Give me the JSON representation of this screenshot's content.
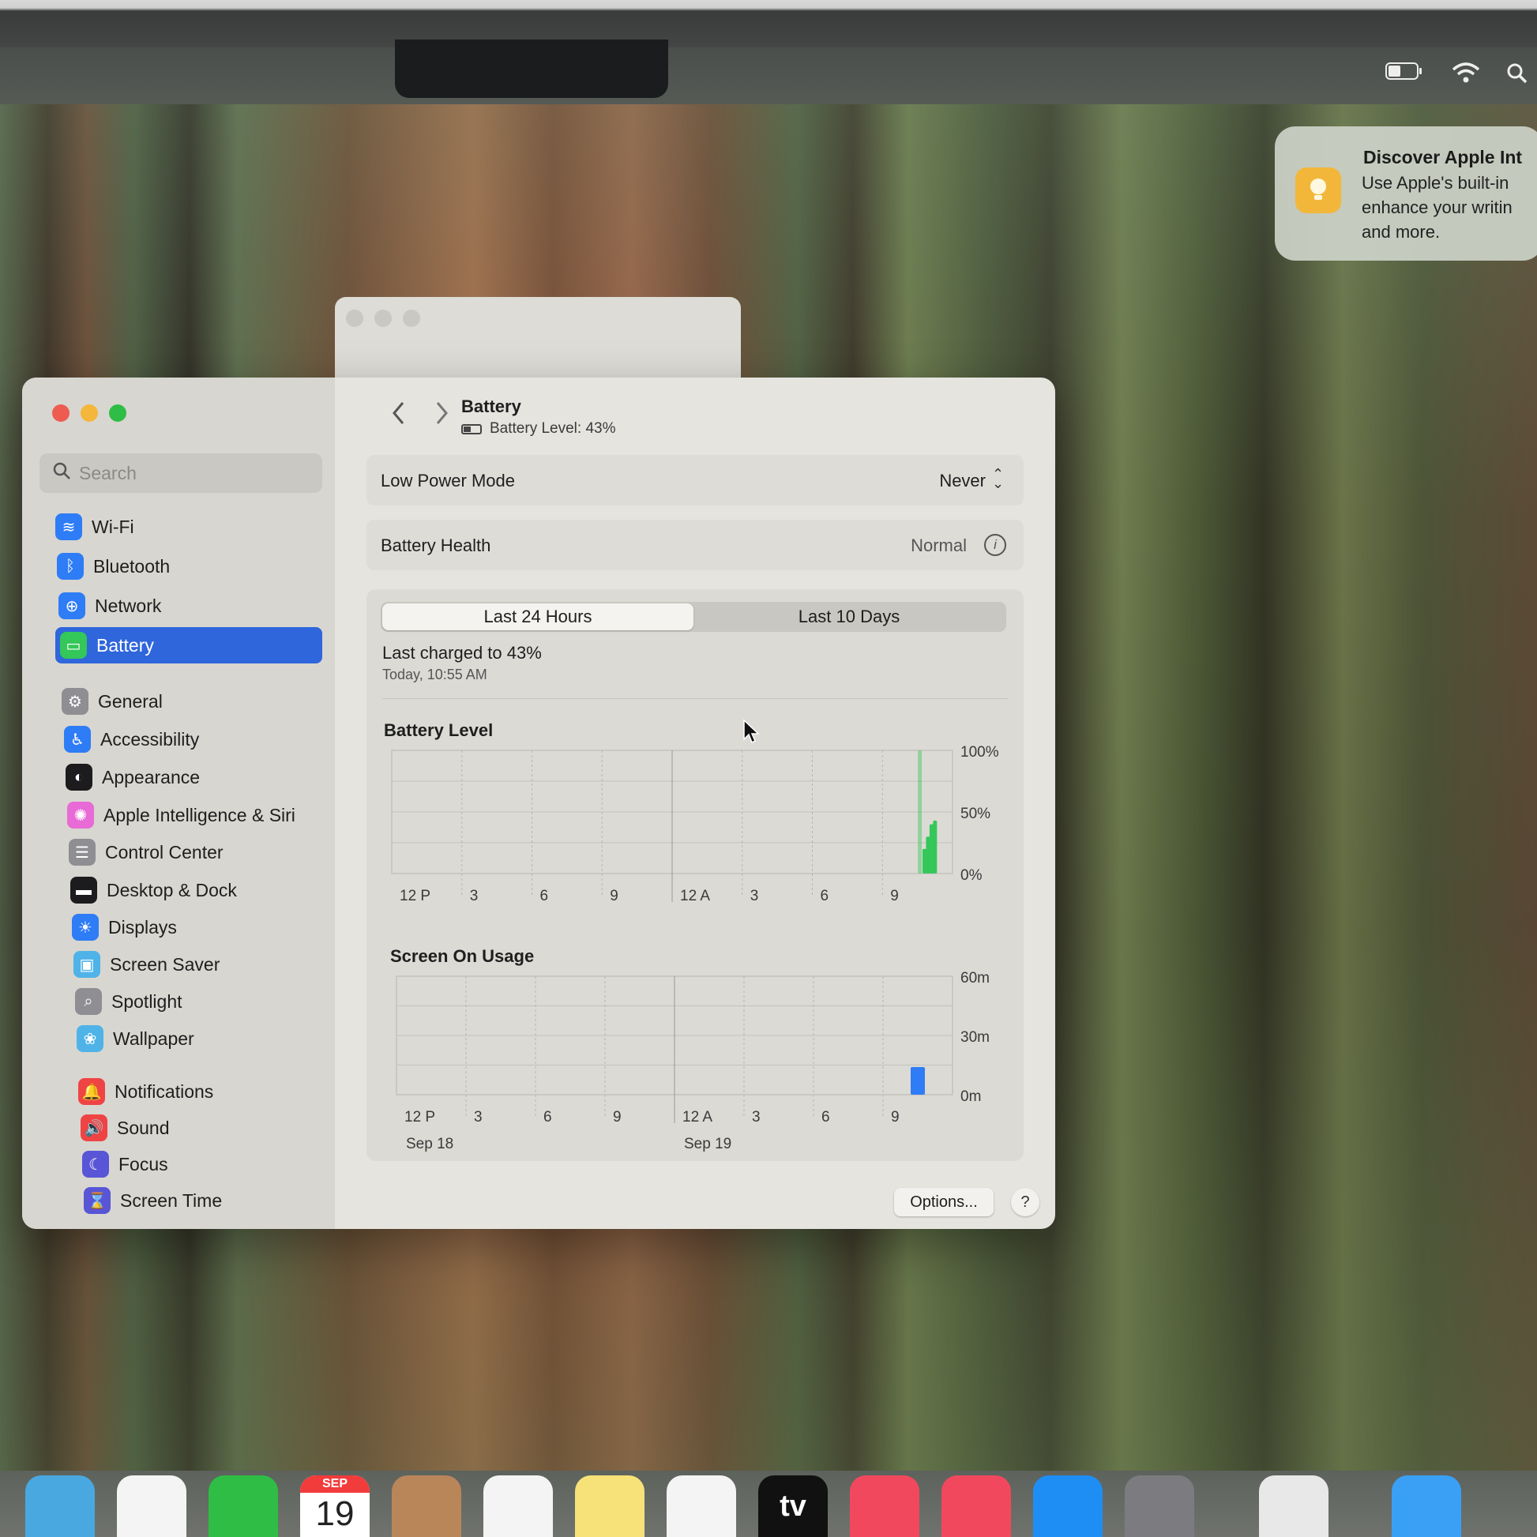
{
  "menubar": {
    "status_icons": [
      "battery-icon",
      "wifi-icon",
      "search-icon"
    ]
  },
  "notification": {
    "title": "Discover Apple Int",
    "body": "Use Apple's built-in enhance your writin and more.",
    "icon": "lightbulb-icon",
    "icon_color": "#f2b73a"
  },
  "window": {
    "traffic_lights": {
      "close": "#ee5b51",
      "minimize": "#f4b63b",
      "zoom": "#2fbd45"
    }
  },
  "search": {
    "placeholder": "Search",
    "value": ""
  },
  "sidebar": {
    "accent": "#2f66dc",
    "items": [
      {
        "label": "Wi-Fi",
        "icon": "wifi-icon",
        "color": "#2e7cf6",
        "glyph": "≋"
      },
      {
        "label": "Bluetooth",
        "icon": "bluetooth-icon",
        "color": "#2e7cf6",
        "glyph": "ᛒ"
      },
      {
        "label": "Network",
        "icon": "globe-icon",
        "color": "#2e7cf6",
        "glyph": "⊕"
      },
      {
        "label": "Battery",
        "icon": "battery-icon",
        "color": "#34c759",
        "glyph": "▭",
        "selected": true
      },
      {
        "label": "General",
        "icon": "gear-icon",
        "color": "#8e8e93",
        "glyph": "⚙"
      },
      {
        "label": "Accessibility",
        "icon": "accessibility-icon",
        "color": "#2e7cf6",
        "glyph": "♿"
      },
      {
        "label": "Appearance",
        "icon": "appearance-icon",
        "color": "#1c1c1e",
        "glyph": "◐"
      },
      {
        "label": "Apple Intelligence & Siri",
        "icon": "siri-icon",
        "color": "#e86ad6",
        "glyph": "✺"
      },
      {
        "label": "Control Center",
        "icon": "control-center-icon",
        "color": "#8e8e93",
        "glyph": "☰"
      },
      {
        "label": "Desktop & Dock",
        "icon": "dock-icon",
        "color": "#1c1c1e",
        "glyph": "▬"
      },
      {
        "label": "Displays",
        "icon": "sun-icon",
        "color": "#2e7cf6",
        "glyph": "☀"
      },
      {
        "label": "Screen Saver",
        "icon": "screensaver-icon",
        "color": "#4fb3e8",
        "glyph": "▣"
      },
      {
        "label": "Spotlight",
        "icon": "magnifier-icon",
        "color": "#8e8e93",
        "glyph": "⌕"
      },
      {
        "label": "Wallpaper",
        "icon": "flower-icon",
        "color": "#4fb3e8",
        "glyph": "❀"
      },
      {
        "label": "Notifications",
        "icon": "bell-icon",
        "color": "#ef4444",
        "glyph": "🔔"
      },
      {
        "label": "Sound",
        "icon": "speaker-icon",
        "color": "#ef4444",
        "glyph": "🔊"
      },
      {
        "label": "Focus",
        "icon": "moon-icon",
        "color": "#5856d6",
        "glyph": "☾"
      },
      {
        "label": "Screen Time",
        "icon": "hourglass-icon",
        "color": "#5856d6",
        "glyph": "⌛"
      }
    ]
  },
  "main": {
    "title": "Battery",
    "battery_level_text": "Battery Level: 43%",
    "low_power_mode": {
      "label": "Low Power Mode",
      "value": "Never"
    },
    "battery_health": {
      "label": "Battery Health",
      "value": "Normal"
    },
    "tabs": [
      {
        "label": "Last 24 Hours",
        "selected": true
      },
      {
        "label": "Last 10 Days",
        "selected": false
      }
    ],
    "last_charged": "Last charged to 43%",
    "last_charged_time": "Today, 10:55 AM",
    "options_label": "Options...",
    "help_label": "?"
  },
  "chart_data": [
    {
      "type": "bar",
      "title": "Battery Level",
      "x_tick_labels": [
        "12 P",
        "3",
        "6",
        "9",
        "12 A",
        "3",
        "6",
        "9"
      ],
      "y_tick_labels": [
        "100%",
        "50%",
        "0%"
      ],
      "ylim": [
        0,
        100
      ],
      "color": "#34c759",
      "series": [
        {
          "values_by_slot": [
            {
              "slot": 22.6,
              "value": 100
            },
            {
              "slot": 22.8,
              "value": 20
            },
            {
              "slot": 22.95,
              "value": 30
            },
            {
              "slot": 23.1,
              "value": 40
            },
            {
              "slot": 23.25,
              "value": 43
            }
          ]
        }
      ]
    },
    {
      "type": "bar",
      "title": "Screen On Usage",
      "x_tick_labels": [
        "12 P",
        "3",
        "6",
        "9",
        "12 A",
        "3",
        "6",
        "9"
      ],
      "x_date_labels": [
        "Sep 18",
        "Sep 19"
      ],
      "y_tick_labels": [
        "60m",
        "30m",
        "0m"
      ],
      "ylim": [
        0,
        60
      ],
      "color": "#2e7cf6",
      "series": [
        {
          "values_by_slot": [
            {
              "slot": 22.5,
              "value": 14
            }
          ]
        }
      ]
    }
  ],
  "dock": {
    "apps": [
      {
        "name": "maps-icon",
        "color": "#4aa8e0"
      },
      {
        "name": "photos-icon",
        "color": "#f4f4f4"
      },
      {
        "name": "facetime-icon",
        "color": "#2fbd45"
      },
      {
        "name": "calendar-icon",
        "color": "#ffffff",
        "month": "SEP",
        "day": "19"
      },
      {
        "name": "contacts-icon",
        "color": "#b9865a"
      },
      {
        "name": "reminders-icon",
        "color": "#f4f4f4"
      },
      {
        "name": "notes-icon",
        "color": "#f7e27a"
      },
      {
        "name": "freeform-icon",
        "color": "#f4f4f4"
      },
      {
        "name": "tv-icon",
        "color": "#111111",
        "label": "tv"
      },
      {
        "name": "music-icon",
        "color": "#f2485d"
      },
      {
        "name": "news-icon",
        "color": "#f2485d"
      },
      {
        "name": "app-store-icon",
        "color": "#1e8ef5"
      },
      {
        "name": "system-settings-icon",
        "color": "#7c7c80"
      },
      {
        "name": "preview-icon",
        "color": "#e8e8e8"
      },
      {
        "name": "downloads-folder-icon",
        "color": "#3aa0f5"
      }
    ]
  }
}
